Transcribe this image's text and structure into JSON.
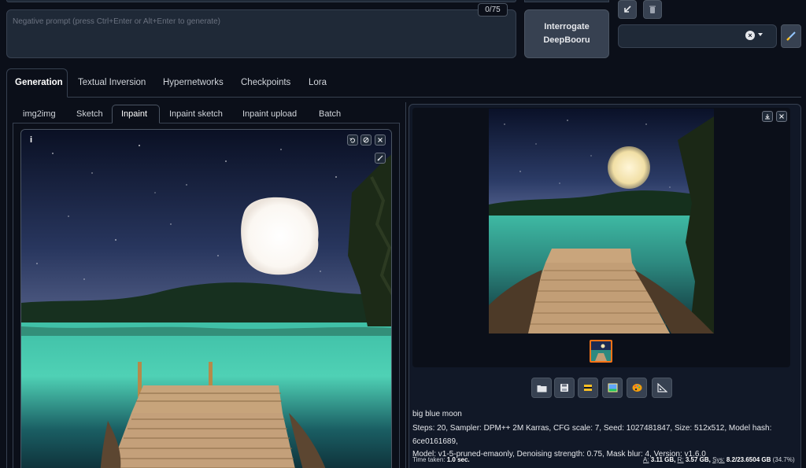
{
  "prompt": {
    "negative_placeholder": "Negative prompt (press Ctrl+Enter or Alt+Enter to generate)",
    "token_count": "0/75"
  },
  "interrogate": {
    "line1": "Interrogate",
    "line2": "DeepBooru"
  },
  "main_tabs": [
    {
      "label": "Generation",
      "active": true
    },
    {
      "label": "Textual Inversion"
    },
    {
      "label": "Hypernetworks"
    },
    {
      "label": "Checkpoints"
    },
    {
      "label": "Lora"
    }
  ],
  "sub_tabs": [
    {
      "label": "img2img"
    },
    {
      "label": "Sketch"
    },
    {
      "label": "Inpaint",
      "active": true
    },
    {
      "label": "Inpaint sketch"
    },
    {
      "label": "Inpaint upload"
    },
    {
      "label": "Batch"
    }
  ],
  "canvas": {
    "info_label": "i"
  },
  "output": {
    "prompt_text": "big blue moon",
    "params_line1": "Steps: 20, Sampler: DPM++ 2M Karras, CFG scale: 7, Seed: 1027481847, Size: 512x512, Model hash: 6ce0161689,",
    "params_line2": "Model: v1-5-pruned-emaonly, Denoising strength: 0.75, Mask blur: 4, Version: v1.6.0",
    "time_label": "Time taken:",
    "time_value": "1.0 sec.",
    "vram_a_label": "A:",
    "vram_a_value": "3.11 GB,",
    "vram_r_label": "R:",
    "vram_r_value": "3.57 GB,",
    "vram_sys_label": "Sys:",
    "vram_sys_value": "8.2/23.6504 GB",
    "vram_pct": "(34.7%)"
  },
  "colors": {
    "background": "#0b0f19",
    "panel": "#1f2937",
    "border": "#374151",
    "thumb_selected": "#f97316"
  },
  "icons": [
    "arrow-down-left-icon",
    "trash-icon",
    "clear-icon",
    "dropdown-caret-icon",
    "brush-icon",
    "undo-icon",
    "eraser-icon",
    "close-icon",
    "brush-size-icon",
    "download-icon",
    "folder-icon",
    "save-icon",
    "zip-icon",
    "image-icon",
    "palette-icon",
    "ruler-icon"
  ]
}
